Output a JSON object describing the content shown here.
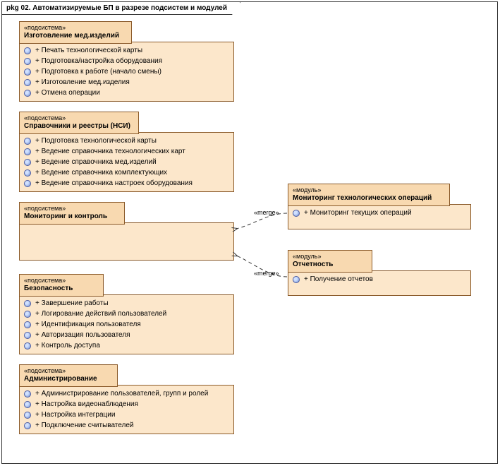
{
  "frame": {
    "title": "pkg 02. Автоматизируемые БП в разрезе подсистем и модулей"
  },
  "packages": {
    "p1": {
      "stereo": "«подсистема»",
      "name": "Изготовление мед.изделий",
      "ops": [
        "+ Печать технологической карты",
        "+ Подготовка/настройка оборудования",
        "+ Подготовка к работе (начало смены)",
        "+ Изготовление мед.изделия",
        "+ Отмена операции"
      ]
    },
    "p2": {
      "stereo": "«подсистема»",
      "name": "Справочники и реестры (НСИ)",
      "ops": [
        "+ Подготовка технологической карты",
        "+ Ведение справочника технологических карт",
        "+ Ведение справочника мед.изделий",
        "+ Ведение справочника комплектующих",
        "+ Ведение справочника настроек оборудования"
      ]
    },
    "p3": {
      "stereo": "«подсистема»",
      "name": "Мониторинг и контроль",
      "ops": []
    },
    "p4": {
      "stereo": "«подсистема»",
      "name": "Безопасность",
      "ops": [
        "+ Завершение работы",
        "+ Логирование действий пользователей",
        "+ Идентификация пользователя",
        "+ Авторизация пользователя",
        "+ Контроль доступа"
      ]
    },
    "p5": {
      "stereo": "«подсистема»",
      "name": "Администрирование",
      "ops": [
        "+ Администрирование пользователей, групп и ролей",
        "+ Настройка видеонаблюдения",
        "+ Настройка интеграции",
        "+ Подключение считывателей"
      ]
    },
    "m1": {
      "stereo": "«модуль»",
      "name": "Мониторинг технологических операций",
      "ops": [
        "+ Мониторинг текущих операций"
      ]
    },
    "m2": {
      "stereo": "«модуль»",
      "name": "Отчетность",
      "ops": [
        "+ Получение отчетов"
      ]
    }
  },
  "merge_label": "«merge»"
}
